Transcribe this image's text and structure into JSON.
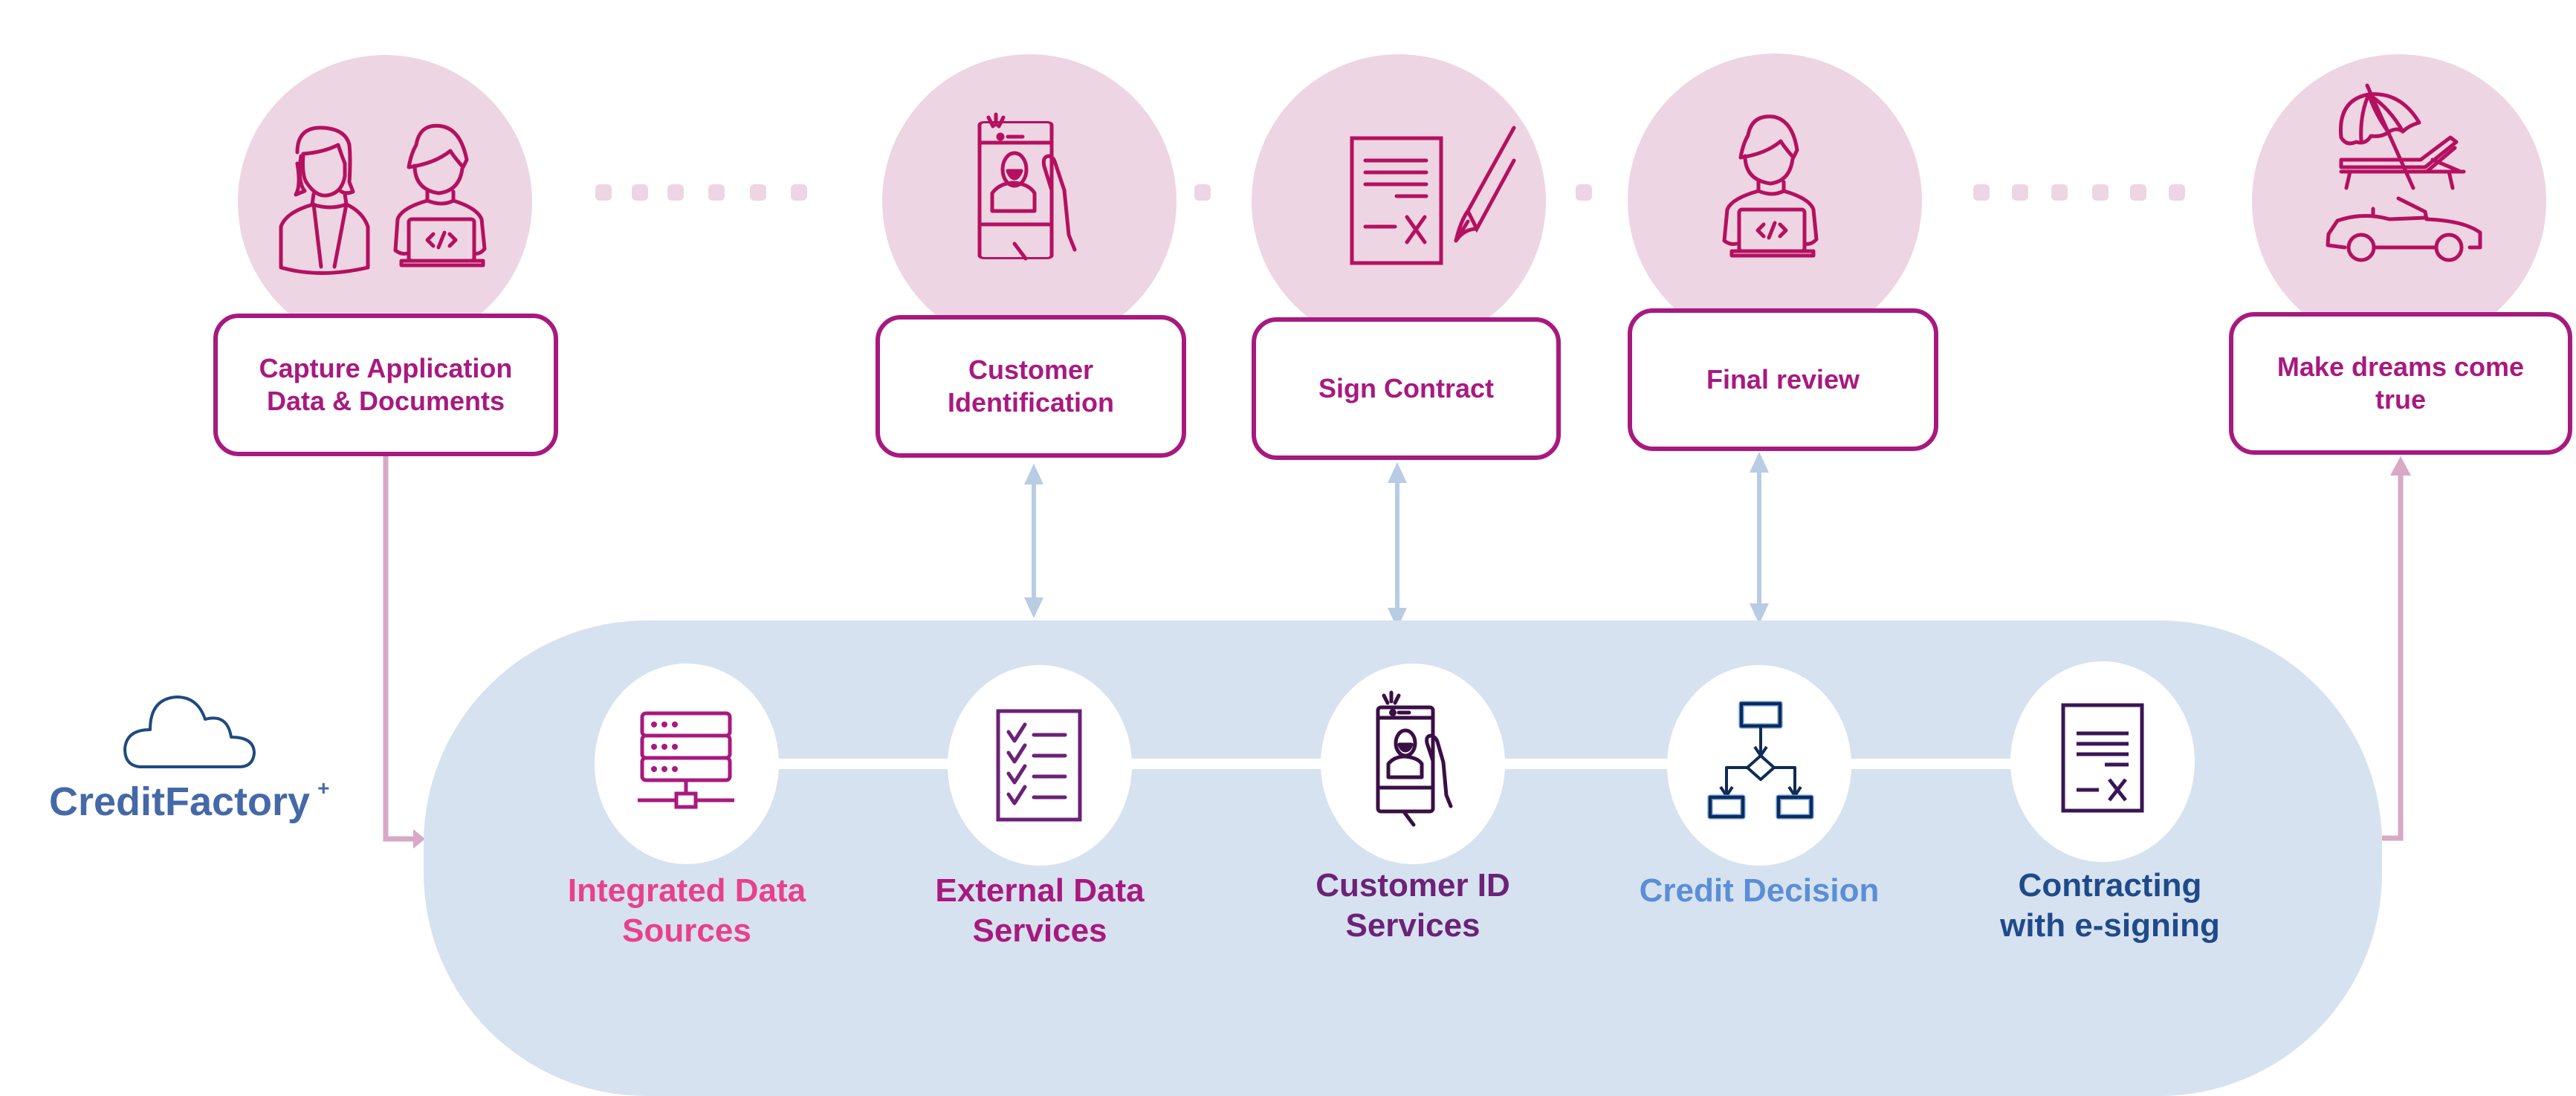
{
  "colors": {
    "step_circle": "#EED5E3",
    "step_border": "#A8197F",
    "step_icon": "#B5105F",
    "band": "#D6E2F0",
    "bidirectional_arrow": "#B8CCE4",
    "flow_connector": "#D7A9C4",
    "logo": "#4569A8",
    "logo_cloud": "#1F4A80"
  },
  "steps": [
    {
      "label": "Capture Application Data & Documents",
      "icon": "people-laptop-icon"
    },
    {
      "label": "Customer Identification",
      "icon": "phone-selfie-icon"
    },
    {
      "label": "Sign Contract",
      "icon": "contract-pen-icon"
    },
    {
      "label": "Final review",
      "icon": "developer-laptop-icon"
    },
    {
      "label": "Make dreams come true",
      "icon": "umbrella-convertible-icon"
    }
  ],
  "logo": {
    "name": "CreditFactory",
    "suffix": "+",
    "icon": "cloud-icon"
  },
  "services": [
    {
      "label_line1": "Integrated Data",
      "label_line2": "Sources",
      "color": "#E8418A",
      "icon": "server-network-icon"
    },
    {
      "label_line1": "External Data",
      "label_line2": "Services",
      "color": "#A8197F",
      "icon": "checklist-icon"
    },
    {
      "label_line1": "Customer ID",
      "label_line2": "Services",
      "color": "#6B2277",
      "icon": "phone-selfie-icon"
    },
    {
      "label_line1": "Credit Decision",
      "label_line2": "",
      "color": "#5B8ED6",
      "icon": "flowchart-icon"
    },
    {
      "label_line1": "Contracting",
      "label_line2": "with e-signing",
      "color": "#1F4A8A",
      "icon": "signed-document-icon"
    }
  ]
}
